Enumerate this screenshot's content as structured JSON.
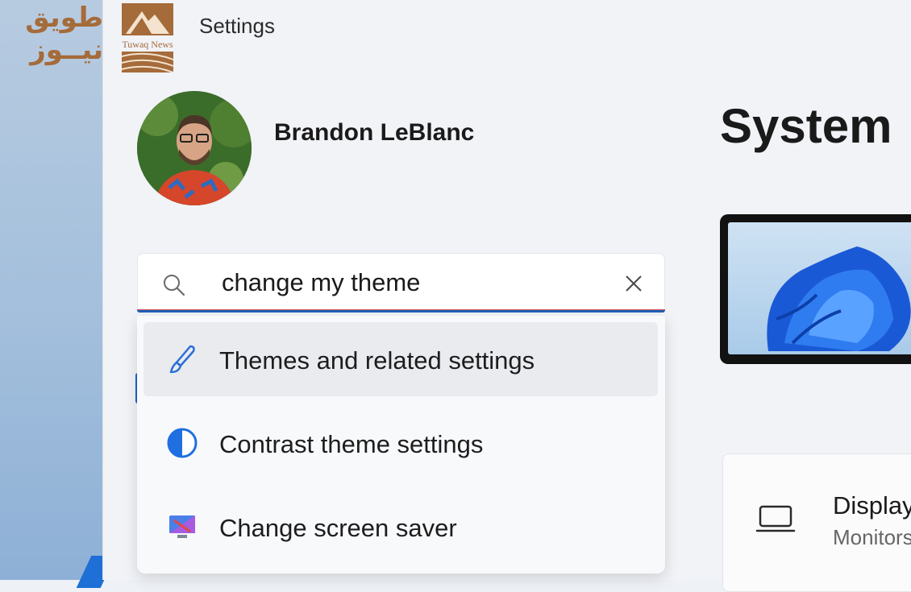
{
  "watermark": {
    "arabic_line1": "طويق",
    "arabic_line2": "نيــوز",
    "brand": "Tuwaq News"
  },
  "window": {
    "title": "Settings"
  },
  "user": {
    "name": "Brandon LeBlanc"
  },
  "search": {
    "value": "change my theme",
    "results": [
      {
        "label": "Themes and related settings",
        "icon": "brush-icon",
        "selected": true
      },
      {
        "label": "Contrast theme settings",
        "icon": "contrast-icon",
        "selected": false
      },
      {
        "label": "Change screen saver",
        "icon": "screensaver-icon",
        "selected": false
      }
    ]
  },
  "main": {
    "page_title": "System",
    "cards": [
      {
        "title": "Display",
        "subtitle": "Monitors",
        "icon": "laptop-icon"
      }
    ]
  },
  "colors": {
    "accent": "#1f5fb8",
    "watermark": "#a56b3a"
  }
}
